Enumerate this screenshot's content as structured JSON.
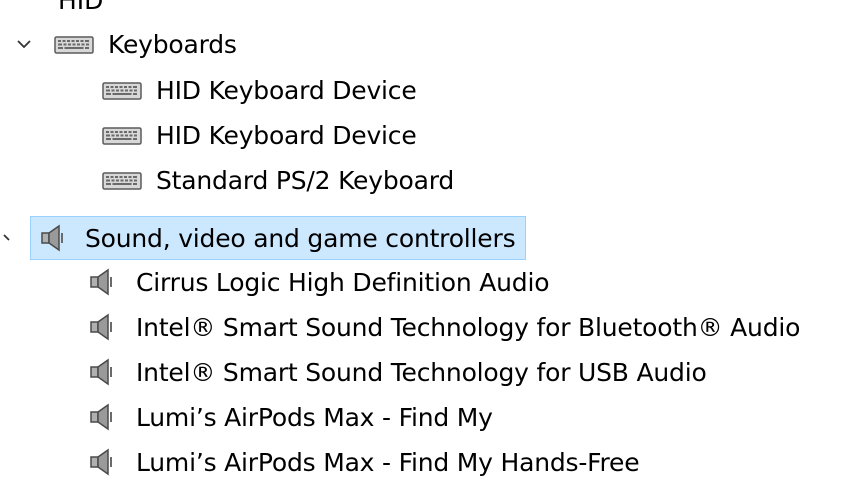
{
  "clipped_top_text": "HID",
  "categories": [
    {
      "label": "Keyboards",
      "icon": "keyboard-icon",
      "expanded": true,
      "selected": false,
      "children": [
        {
          "label": "HID Keyboard Device",
          "icon": "keyboard-icon"
        },
        {
          "label": "HID Keyboard Device",
          "icon": "keyboard-icon"
        },
        {
          "label": "Standard PS/2 Keyboard",
          "icon": "keyboard-icon"
        }
      ]
    },
    {
      "label": "Sound, video and game controllers",
      "icon": "speaker-icon",
      "expanded": true,
      "selected": true,
      "children": [
        {
          "label": "Cirrus Logic High Definition Audio",
          "icon": "speaker-icon"
        },
        {
          "label": "Intel® Smart Sound Technology for Bluetooth® Audio",
          "icon": "speaker-icon"
        },
        {
          "label": "Intel® Smart Sound Technology for USB Audio",
          "icon": "speaker-icon"
        },
        {
          "label": "Lumi’s AirPods Max - Find My",
          "icon": "speaker-icon"
        },
        {
          "label": "Lumi’s AirPods Max - Find My Hands-Free",
          "icon": "speaker-icon"
        }
      ]
    }
  ],
  "colors": {
    "selection_fill": "#cce8ff",
    "selection_border": "#99d1ff",
    "text": "#000000"
  }
}
